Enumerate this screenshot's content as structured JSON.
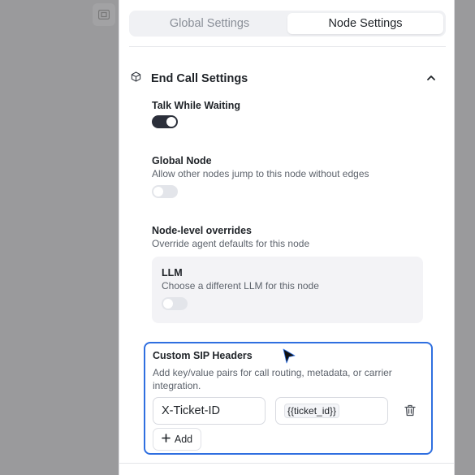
{
  "tabs": [
    {
      "label": "Global Settings",
      "active": false
    },
    {
      "label": "Node Settings",
      "active": true
    }
  ],
  "section": {
    "title": "End Call Settings",
    "icon": "cube-icon",
    "expanded": true
  },
  "talk_while_waiting": {
    "label": "Talk While Waiting",
    "enabled": true
  },
  "global_node": {
    "label": "Global Node",
    "description": "Allow other nodes jump to this node without edges",
    "enabled": false
  },
  "overrides": {
    "label": "Node-level overrides",
    "description": "Override agent defaults for this node"
  },
  "llm": {
    "label": "LLM",
    "description": "Choose a different LLM for this node",
    "enabled": false
  },
  "sip": {
    "label": "Custom SIP Headers",
    "description": "Add key/value pairs for call routing, metadata, or carrier integration.",
    "headers": [
      {
        "key": "X-Ticket-ID",
        "value": "{{ticket_id}}"
      }
    ],
    "add_label": "Add"
  },
  "colors": {
    "accent": "#2f6fe0",
    "toggle_on": "#2b2f3a"
  }
}
